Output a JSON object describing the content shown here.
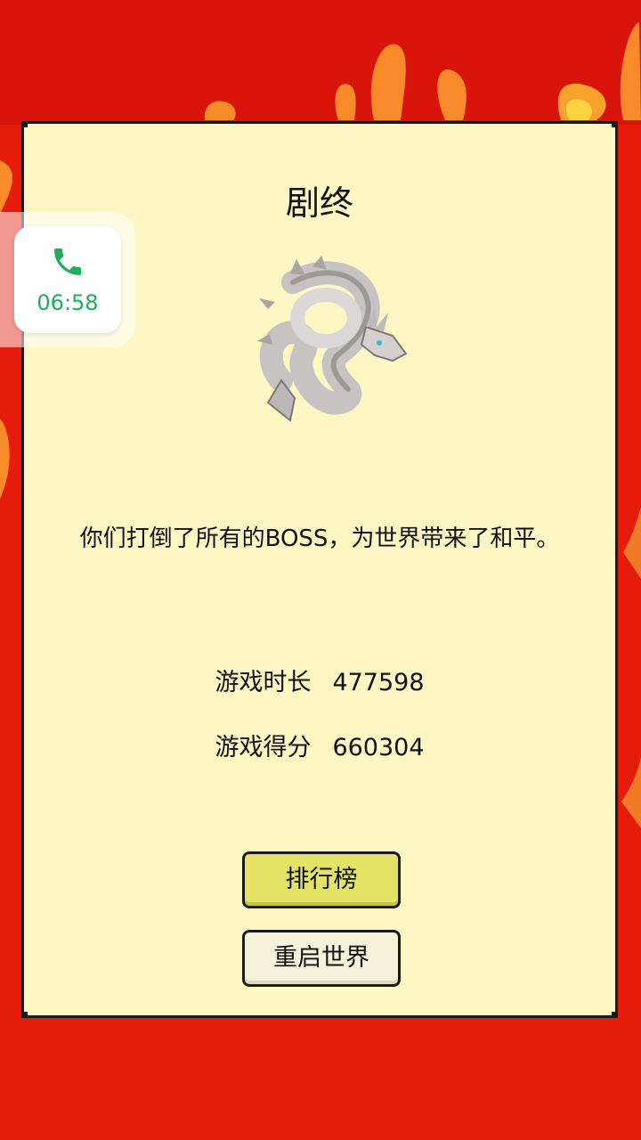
{
  "dialog": {
    "title": "剧终",
    "message": "你们打倒了所有的BOSS，为世界带来了和平。",
    "stats": [
      {
        "label": "游戏时长",
        "value": "477598"
      },
      {
        "label": "游戏得分",
        "value": "660304"
      }
    ],
    "buttons": {
      "leaderboard": "排行榜",
      "restart": "重启世界"
    }
  },
  "call_widget": {
    "time": "06:58",
    "icon": "phone-icon"
  },
  "colors": {
    "background": "#e51c0c",
    "panel": "#fef6c3",
    "button_primary": "#e3e365",
    "button_secondary": "#f4f3da",
    "call_green": "#1fae5b"
  }
}
